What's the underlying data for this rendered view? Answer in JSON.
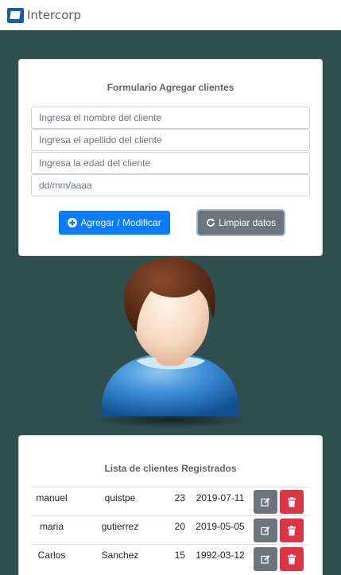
{
  "navbar": {
    "brand": "Intercorp",
    "logo_icon": "intercorp-logo"
  },
  "form": {
    "title": "Formulario Agregar clientes",
    "name_placeholder": "Ingresa el nombre del cliente",
    "lastname_placeholder": "Ingresa el apellido del cliente",
    "age_placeholder": "Ingresa la edad del cliente",
    "date_placeholder": "dd/mm/aaaa",
    "add_button": "Agregar / Modificar",
    "add_icon": "plus-circle-icon",
    "clear_button": "Limpiar datos",
    "clear_icon": "refresh-icon"
  },
  "list": {
    "title": "Lista de clientes Registrados",
    "rows": [
      {
        "name": "manuel",
        "lastname": "quistpe",
        "age": "23",
        "date": "2019-07-11"
      },
      {
        "name": "maria",
        "lastname": "gutierrez",
        "age": "20",
        "date": "2019-05-05"
      },
      {
        "name": "Carlos",
        "lastname": "Sanchez",
        "age": "15",
        "date": "1992-03-12"
      }
    ],
    "edit_icon": "edit-icon",
    "delete_icon": "trash-icon"
  },
  "colors": {
    "background": "#2f4f4f",
    "primary": "#0a7cff",
    "secondary": "#6c757d",
    "danger": "#dc3545",
    "brand": "#1a5ba8"
  }
}
